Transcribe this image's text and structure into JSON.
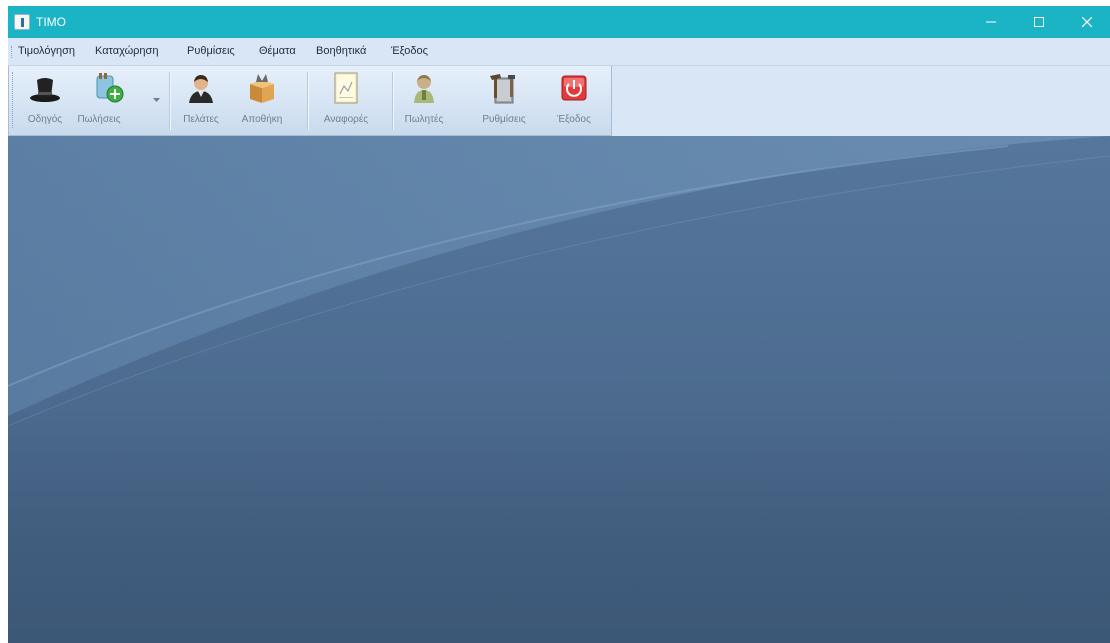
{
  "window": {
    "title": "TIMO",
    "controls": {
      "minimize": "minimize",
      "maximize": "maximize",
      "close": "close"
    }
  },
  "menu": {
    "items": [
      "Τιμολόγηση",
      "Καταχώρηση",
      "Ρυθμίσεις",
      "Θέματα",
      "Βοηθητικά",
      "Έξοδος"
    ]
  },
  "toolbar": {
    "buttons": [
      {
        "label": "Οδηγός",
        "icon": "top-hat-icon"
      },
      {
        "label": "Πωλήσεις",
        "icon": "sales-add-icon"
      },
      {
        "label": "Πελάτες",
        "icon": "customer-icon"
      },
      {
        "label": "Αποθήκη",
        "icon": "warehouse-box-icon"
      },
      {
        "label": "Αναφορές",
        "icon": "report-icon"
      },
      {
        "label": "Πωλητές",
        "icon": "salesman-icon"
      },
      {
        "label": "Ρυθμίσεις",
        "icon": "settings-tools-icon"
      },
      {
        "label": "Έξοδος",
        "icon": "power-exit-icon"
      }
    ]
  },
  "colors": {
    "titlebar": "#1bb4c5",
    "menubar": "#d8e6f6",
    "workspace": "#4b6b8f"
  }
}
